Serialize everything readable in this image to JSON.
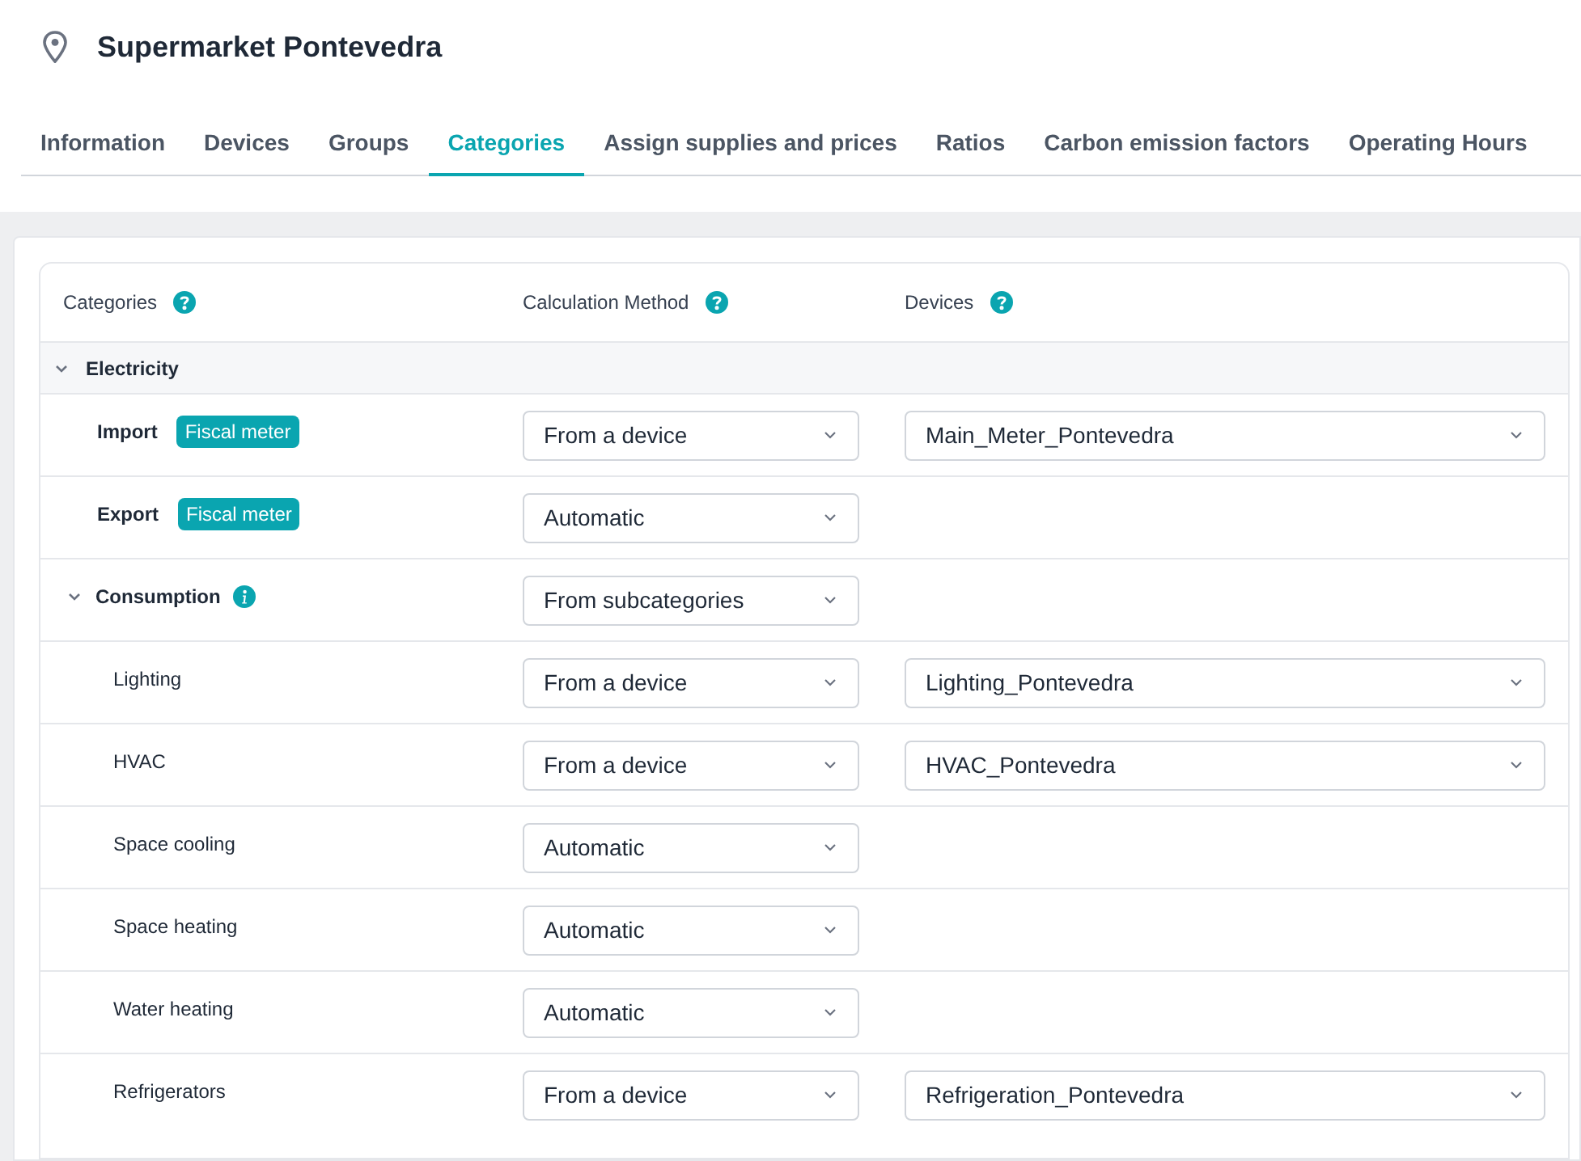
{
  "location": {
    "title": "Supermarket Pontevedra"
  },
  "tabs": [
    {
      "label": "Information",
      "selected": false
    },
    {
      "label": "Devices",
      "selected": false
    },
    {
      "label": "Groups",
      "selected": false
    },
    {
      "label": "Categories",
      "selected": true
    },
    {
      "label": "Assign supplies and prices",
      "selected": false
    },
    {
      "label": "Ratios",
      "selected": false
    },
    {
      "label": "Carbon emission factors",
      "selected": false
    },
    {
      "label": "Operating Hours",
      "selected": false
    }
  ],
  "table": {
    "columns": [
      {
        "label": "Categories"
      },
      {
        "label": "Calculation Method"
      },
      {
        "label": "Devices"
      }
    ],
    "groups": [
      {
        "label": "Electricity",
        "expanded": true,
        "rows": [
          {
            "kind": "main",
            "label": "Import",
            "badge": "Fiscal meter",
            "method": "From a device",
            "device": "Main_Meter_Pontevedra"
          },
          {
            "kind": "main",
            "label": "Export",
            "badge": "Fiscal meter",
            "method": "Automatic"
          },
          {
            "kind": "parent",
            "label": "Consumption",
            "expanded": true,
            "method": "From subcategories",
            "children": [
              {
                "kind": "sub",
                "label": "Lighting",
                "method": "From a device",
                "device": "Lighting_Pontevedra"
              },
              {
                "kind": "sub",
                "label": "HVAC",
                "method": "From a device",
                "device": "HVAC_Pontevedra"
              },
              {
                "kind": "sub",
                "label": "Space cooling",
                "method": "Automatic"
              },
              {
                "kind": "sub",
                "label": "Space heating",
                "method": "Automatic"
              },
              {
                "kind": "sub",
                "label": "Water heating",
                "method": "Automatic"
              },
              {
                "kind": "sub",
                "label": "Refrigerators",
                "method": "From a device",
                "device": "Refrigeration_Pontevedra"
              }
            ]
          }
        ]
      }
    ]
  }
}
